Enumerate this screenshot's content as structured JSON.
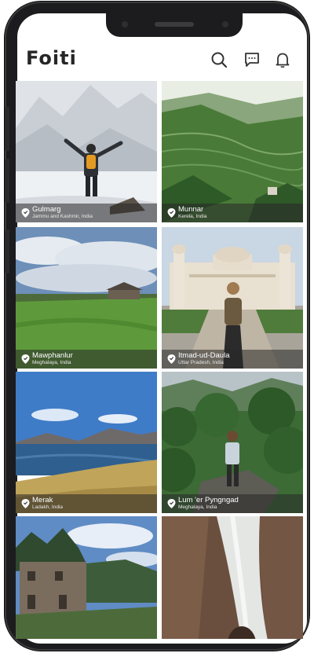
{
  "app": {
    "logo_text": "Foiti",
    "icons": [
      "search-icon",
      "chat-icon",
      "bell-icon"
    ]
  },
  "feed": {
    "places": [
      {
        "name": "Gulmarg",
        "region": "Jammu and Kashmir, India"
      },
      {
        "name": "Munnar",
        "region": "Kerela, India"
      },
      {
        "name": "Mawphanlur",
        "region": "Meghalaya, India"
      },
      {
        "name": "Itmad-ud-Daula",
        "region": "Uttar Pradesh, India"
      },
      {
        "name": "Merak",
        "region": "Ladakh, India"
      },
      {
        "name": "Lum 'er Pyngngad",
        "region": "Meghalaya, India"
      },
      {
        "name": "",
        "region": ""
      },
      {
        "name": "",
        "region": ""
      }
    ]
  },
  "colors": {
    "frame": "#1c1c1e",
    "caption_bg": "#282828",
    "icon": "#333333"
  }
}
